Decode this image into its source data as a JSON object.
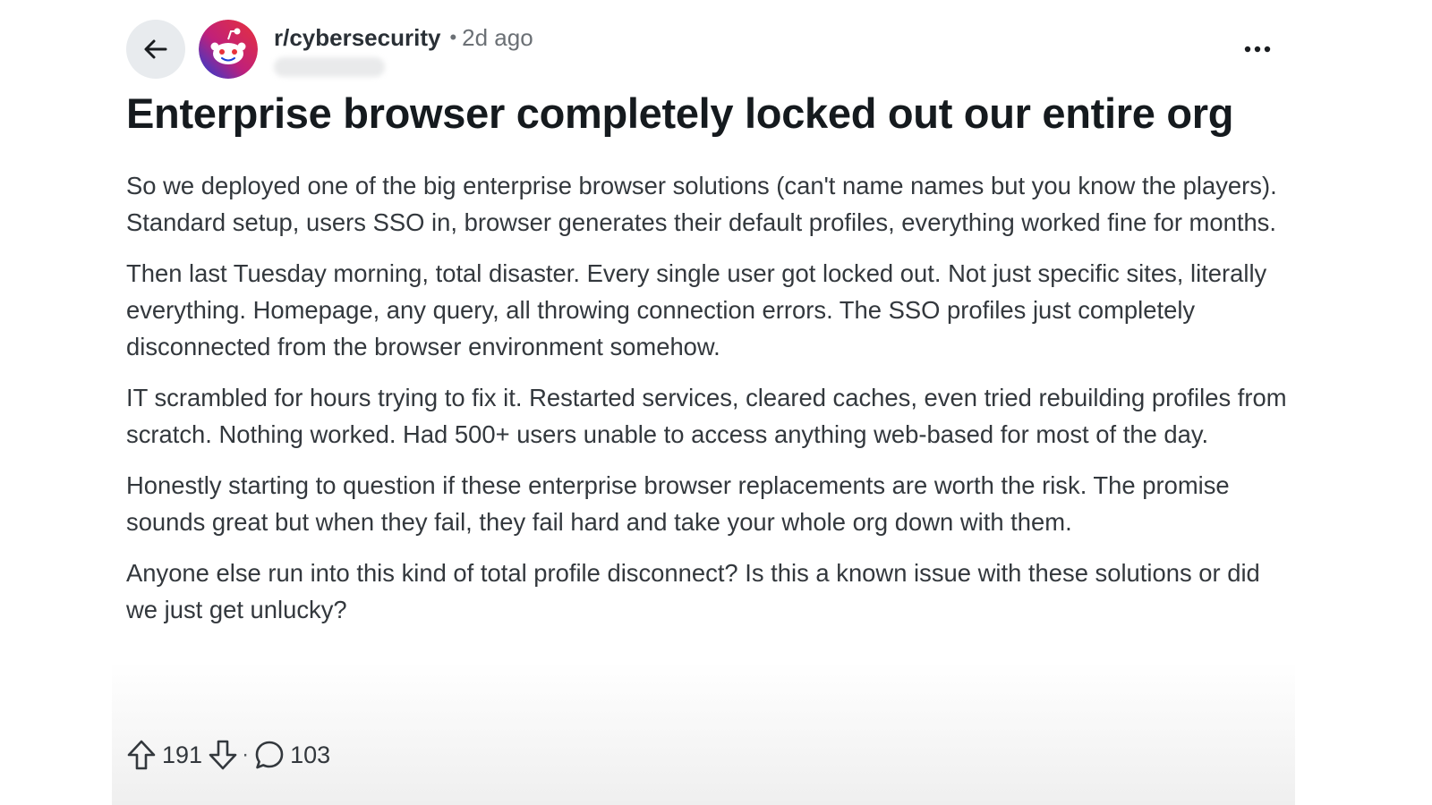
{
  "post": {
    "subreddit": "r/cybersecurity",
    "separator": "•",
    "time_ago": "2d ago",
    "title": "Enterprise browser completely locked out our entire org",
    "paragraphs": [
      "So we deployed one of the big enterprise browser solutions (can't name names but you know the players). Standard setup, users SSO in, browser generates their default profiles, everything worked fine for months.",
      "Then last Tuesday morning, total disaster. Every single user got locked out. Not just specific sites, literally everything. Homepage, any query, all throwing connection errors. The SSO profiles just completely disconnected from the browser environment somehow.",
      "IT scrambled for hours trying to fix it. Restarted services, cleared caches, even tried rebuilding profiles from scratch. Nothing worked. Had 500+ users unable to access anything web-based for most of the day.",
      "Honestly starting to question if these enterprise browser replacements are worth the risk. The promise sounds great but when they fail, they fail hard and take your whole org down with them.",
      "Anyone else run into this kind of total profile disconnect? Is this a known issue with these solutions or did we just get unlucky?"
    ]
  },
  "actions": {
    "upvotes": "191",
    "separator": "·",
    "comments": "103"
  },
  "icons": {
    "back": "arrow-left-icon",
    "avatar": "reddit-snoo-avatar",
    "more": "more-horizontal-icon",
    "upvote": "arrow-up-outline-icon",
    "downvote": "arrow-down-outline-icon",
    "comment": "speech-bubble-icon"
  },
  "colors": {
    "avatar_gradient_start": "#e8323a",
    "avatar_gradient_end": "#1f3fd8"
  }
}
